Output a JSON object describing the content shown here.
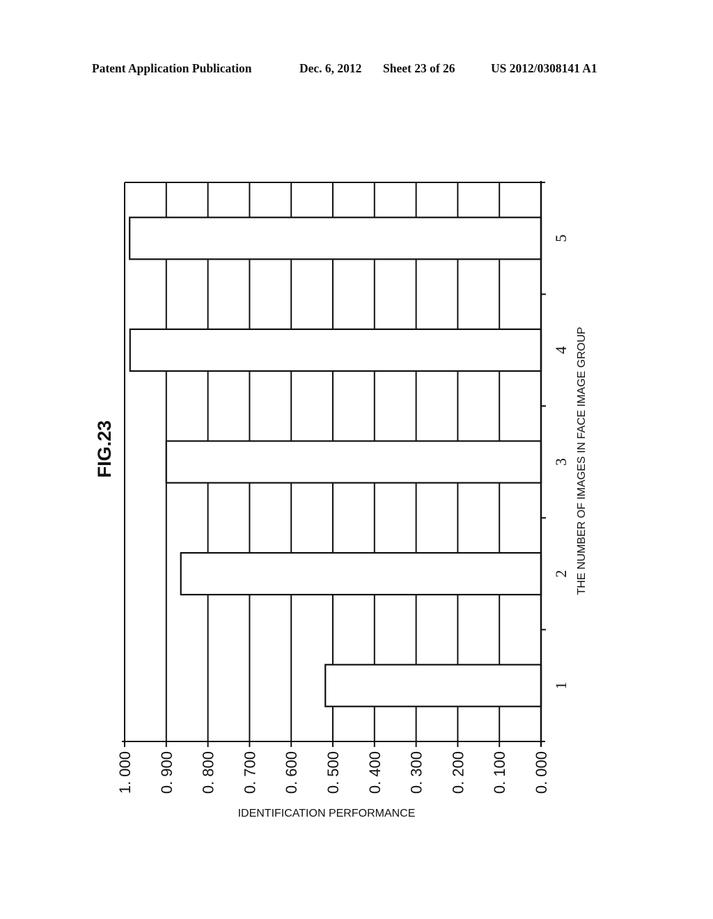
{
  "header": {
    "publication": "Patent Application Publication",
    "date": "Dec. 6, 2012",
    "sheet": "Sheet 23 of 26",
    "number": "US 2012/0308141 A1"
  },
  "chart_data": {
    "type": "bar",
    "orientation": "rotated (page printed sideways)",
    "title": "FIG.23",
    "xlabel": "THE NUMBER OF IMAGES IN FACE IMAGE GROUP",
    "ylabel": "IDENTIFICATION PERFORMANCE",
    "categories": [
      "1",
      "2",
      "3",
      "4",
      "5"
    ],
    "values": [
      0.518,
      0.865,
      0.9,
      0.987,
      0.988
    ],
    "ylim": [
      0,
      1.0
    ],
    "yticks": [
      "0. 000",
      "0. 100",
      "0. 200",
      "0. 300",
      "0. 400",
      "0. 500",
      "0. 600",
      "0. 700",
      "0. 800",
      "0. 900",
      "1. 000"
    ],
    "grid": true,
    "legend": "none",
    "colors": {
      "bar_fill": "#ffffff",
      "bar_stroke": "#111111",
      "grid": "#111111"
    }
  }
}
